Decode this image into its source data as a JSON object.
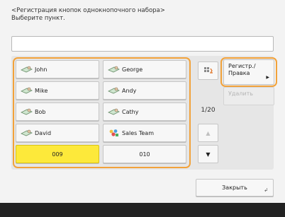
{
  "header": {
    "title": "<Регистрация кнопок однокнопочного набора>",
    "instruction": "Выберите пункт."
  },
  "name_field": {
    "value": ""
  },
  "one_touch": [
    {
      "label": "John",
      "icon": "person-icon"
    },
    {
      "label": "George",
      "icon": "person-icon"
    },
    {
      "label": "Mike",
      "icon": "person-icon"
    },
    {
      "label": "Andy",
      "icon": "person-icon"
    },
    {
      "label": "Bob",
      "icon": "person-icon"
    },
    {
      "label": "Cathy",
      "icon": "person-icon"
    },
    {
      "label": "David",
      "icon": "person-icon"
    },
    {
      "label": "Sales Team",
      "icon": "group-icon"
    },
    {
      "label": "009",
      "icon": "",
      "selected": true
    },
    {
      "label": "010",
      "icon": ""
    }
  ],
  "paging": {
    "indicator": "1/20"
  },
  "actions": {
    "register_edit_label_line1": "Регистр./",
    "register_edit_label_line2": "Правка",
    "delete_label": "Удалить"
  },
  "close_label": "Закрыть",
  "colors": {
    "accent": "#f2a23a",
    "selected": "#fde93a"
  }
}
